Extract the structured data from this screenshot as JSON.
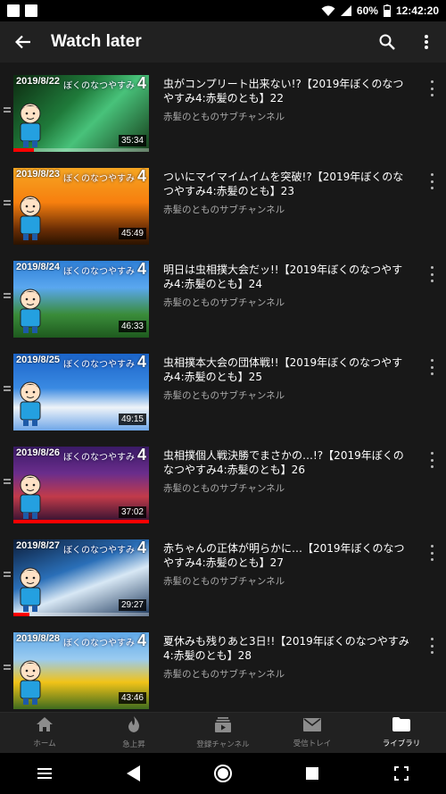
{
  "status_bar": {
    "battery": "60%",
    "time": "12:42:20"
  },
  "app_bar": {
    "title": "Watch later",
    "back_icon": "arrow-back-icon",
    "search_icon": "search-icon",
    "more_icon": "more-vert-icon"
  },
  "videos": [
    {
      "date": "2019/8/22",
      "title": "虫がコンプリート出来ない!?【2019年ぼくのなつやすみ4:赤髪のとも】22",
      "channel": "赤髪のとものサブチャンネル",
      "duration": "35:34",
      "progress": 0.15,
      "theme": "green"
    },
    {
      "date": "2019/8/23",
      "title": "ついにマイマイムイムを突破!?【2019年ぼくのなつやすみ4:赤髪のとも】23",
      "channel": "赤髪のとものサブチャンネル",
      "duration": "45:49",
      "progress": 0.0,
      "theme": "sunset"
    },
    {
      "date": "2019/8/24",
      "title": "明日は虫相撲大会だッ!!【2019年ぼくのなつやすみ4:赤髪のとも】24",
      "channel": "赤髪のとものサブチャンネル",
      "duration": "46:33",
      "progress": 0.0,
      "theme": "flower"
    },
    {
      "date": "2019/8/25",
      "title": "虫相撲本大会の団体戦!!【2019年ぼくのなつやすみ4:赤髪のとも】25",
      "channel": "赤髪のとものサブチャンネル",
      "duration": "49:15",
      "progress": 0.0,
      "theme": "sky"
    },
    {
      "date": "2019/8/26",
      "title": "虫相撲個人戦決勝でまさかの…!?【2019年ぼくのなつやすみ4:赤髪のとも】26",
      "channel": "赤髪のとものサブチャンネル",
      "duration": "37:02",
      "progress": 1.0,
      "theme": "festival"
    },
    {
      "date": "2019/8/27",
      "title": "赤ちゃんの正体が明らかに…【2019年ぼくのなつやすみ4:赤髪のとも】27",
      "channel": "赤髪のとものサブチャンネル",
      "duration": "29:27",
      "progress": 0.12,
      "theme": "bottles"
    },
    {
      "date": "2019/8/28",
      "title": "夏休みも残りあと3日!!【2019年ぼくのなつやすみ4:赤髪のとも】28",
      "channel": "赤髪のとものサブチャンネル",
      "duration": "43:46",
      "progress": 0.0,
      "theme": "sunflower"
    }
  ],
  "thumbnail_logo": "ぼくのなつやすみ",
  "thumbnail_logo_num": "4",
  "bottom_nav": [
    {
      "label": "ホーム",
      "icon": "home-icon",
      "active": false
    },
    {
      "label": "急上昇",
      "icon": "trending-flame-icon",
      "active": false
    },
    {
      "label": "登録チャンネル",
      "icon": "subscriptions-icon",
      "active": false
    },
    {
      "label": "受信トレイ",
      "icon": "inbox-mail-icon",
      "active": false
    },
    {
      "label": "ライブラリ",
      "icon": "library-folder-icon",
      "active": true
    }
  ],
  "colors": {
    "progress": "#ff0000",
    "background": "#181818",
    "bar": "#212121",
    "secondary_text": "#aaaaaa"
  }
}
